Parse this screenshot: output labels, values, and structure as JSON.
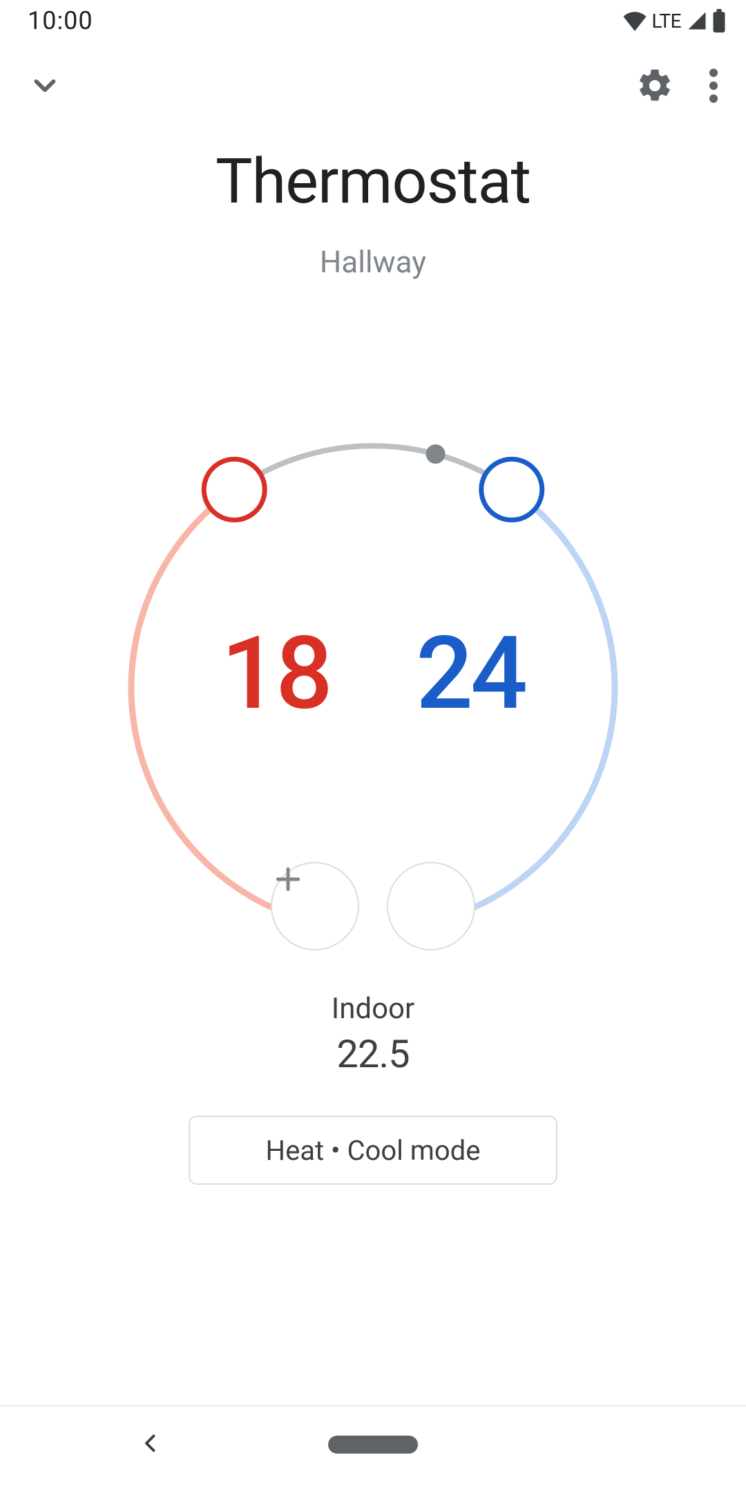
{
  "status_bar": {
    "time": "10:00",
    "network_label": "LTE"
  },
  "header": {
    "title": "Thermostat",
    "room": "Hallway"
  },
  "dial": {
    "heat_setpoint": "18",
    "cool_setpoint": "24",
    "current_indicator_angle_deg": -75,
    "heat_handle_angle_deg": -125,
    "cool_handle_angle_deg": -55,
    "colors": {
      "heat": "#d93025",
      "heat_arc": "#f7b6a7",
      "cool": "#1a5dc9",
      "cool_arc": "#bcd4f5",
      "track": "#bdc1c6"
    }
  },
  "indoor": {
    "label": "Indoor",
    "value": "22.5"
  },
  "mode": {
    "label": "Heat • Cool mode"
  }
}
